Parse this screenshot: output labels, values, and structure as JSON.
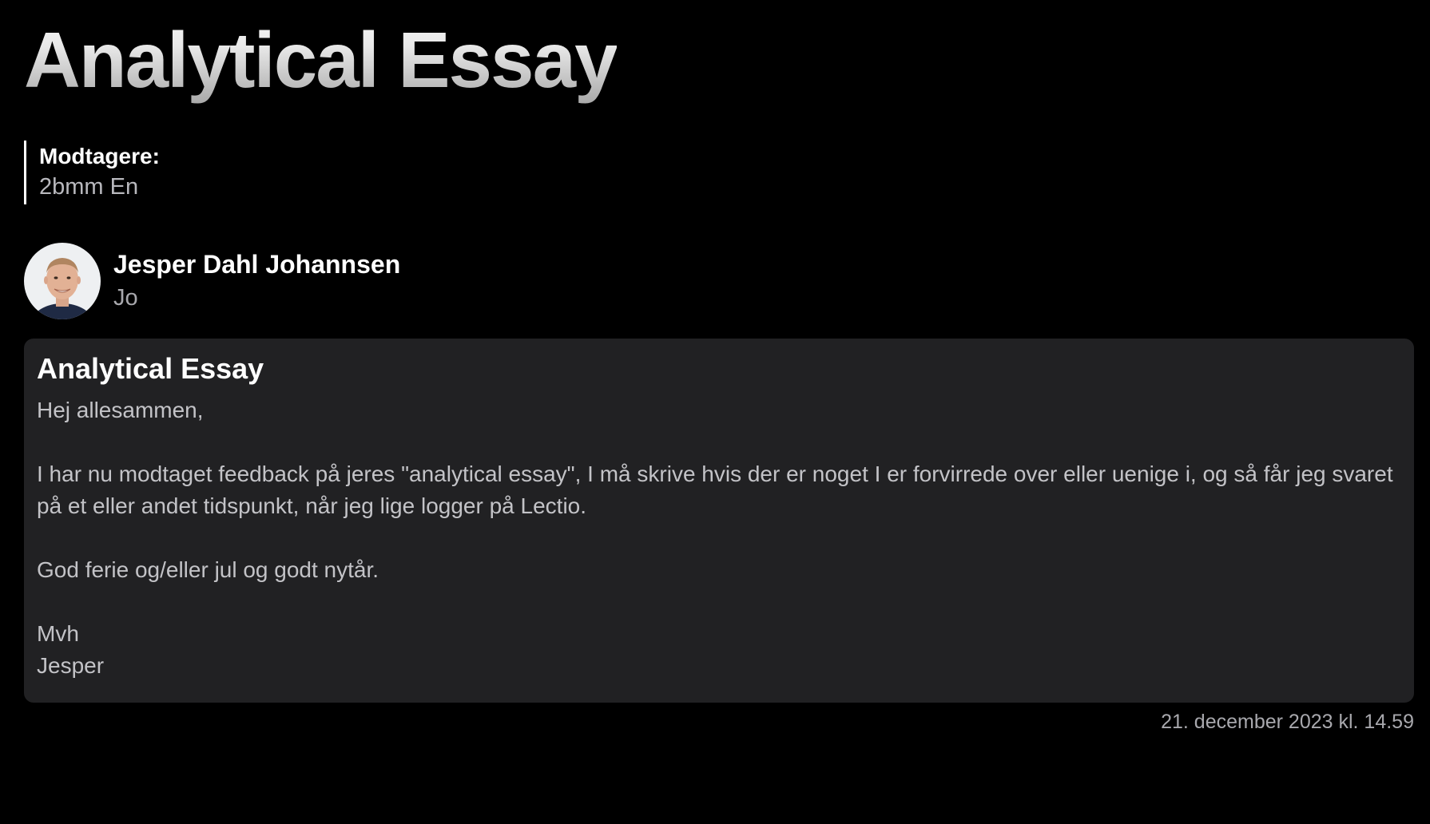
{
  "page": {
    "title": "Analytical Essay"
  },
  "recipients": {
    "label": "Modtagere:",
    "value": "2bmm En"
  },
  "sender": {
    "name": "Jesper Dahl Johannsen",
    "initials": "Jo",
    "avatar_icon": "person-photo-avatar"
  },
  "message": {
    "subject": "Analytical Essay",
    "greeting": "Hej allesammen,",
    "paragraph_1": "I har nu modtaget feedback på jeres \"analytical essay\", I må skrive hvis der er noget I er forvirrede over eller uenige i, og så får jeg svaret på et eller andet tidspunkt, når jeg lige logger på Lectio.",
    "paragraph_2": "God ferie og/eller jul og godt nytår.",
    "closing": "Mvh",
    "signature": "Jesper"
  },
  "timestamp": "21. december 2023 kl. 14.59",
  "colors": {
    "background": "#000000",
    "card": "#212123",
    "text_primary": "#ffffff",
    "text_secondary": "#c3c3c7"
  }
}
